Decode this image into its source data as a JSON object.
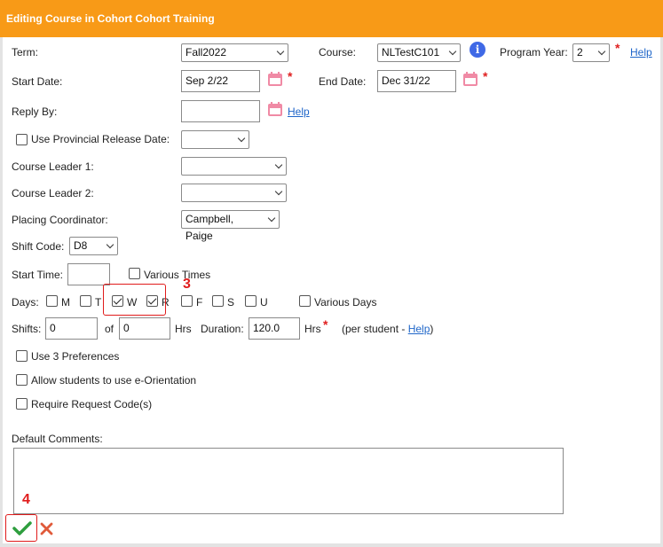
{
  "header": {
    "title": "Editing Course in Cohort Cohort Training"
  },
  "form": {
    "term": {
      "label": "Term:",
      "value": "Fall2022"
    },
    "course": {
      "label": "Course:",
      "value": "NLTestC101"
    },
    "program_year": {
      "label": "Program Year:",
      "value": "2",
      "help": "Help"
    },
    "start_date": {
      "label": "Start Date:",
      "value": "Sep 2/22"
    },
    "end_date": {
      "label": "End Date:",
      "value": "Dec 31/22"
    },
    "reply_by": {
      "label": "Reply By:",
      "value": "",
      "help": "Help"
    },
    "provincial_release": {
      "label": "Use Provincial Release Date:",
      "checked": false,
      "value": ""
    },
    "course_leader_1": {
      "label": "Course Leader 1:",
      "value": ""
    },
    "course_leader_2": {
      "label": "Course Leader 2:",
      "value": ""
    },
    "placing_coordinator": {
      "label": "Placing Coordinator:",
      "value": "Campbell, Paige"
    },
    "shift_code": {
      "label": "Shift Code:",
      "value": "D8"
    },
    "start_time": {
      "label": "Start Time:",
      "value": ""
    },
    "various_times": {
      "label": "Various Times",
      "checked": false
    },
    "days": {
      "label": "Days:",
      "items": [
        {
          "label": "M",
          "checked": false
        },
        {
          "label": "T",
          "checked": false
        },
        {
          "label": "W",
          "checked": true
        },
        {
          "label": "R",
          "checked": true
        },
        {
          "label": "F",
          "checked": false
        },
        {
          "label": "S",
          "checked": false
        },
        {
          "label": "U",
          "checked": false
        }
      ],
      "various": {
        "label": "Various Days",
        "checked": false
      }
    },
    "shifts": {
      "label": "Shifts:",
      "value": "0",
      "of_label": "of",
      "of_value": "0",
      "hrs_label": "Hrs",
      "duration_label": "Duration:",
      "duration_value": "120.0",
      "duration_hrs_label": "Hrs",
      "per_student_prefix": "(per student - ",
      "per_student_help": "Help",
      "per_student_suffix": ")"
    },
    "use_3_preferences": {
      "label": "Use 3 Preferences",
      "checked": false
    },
    "allow_e_orientation": {
      "label": "Allow students to use e-Orientation",
      "checked": false
    },
    "require_request_code": {
      "label": "Require Request Code(s)",
      "checked": false
    },
    "default_comments": {
      "label": "Default Comments:",
      "value": ""
    }
  },
  "required_marker": "*",
  "annotations": {
    "days_step": "3",
    "save_step": "4"
  },
  "colors": {
    "header": "#f89a17",
    "calendar": "#f08aa5",
    "info": "#3f69e6",
    "save": "#2e9e3e",
    "cancel": "#e05a3a",
    "annotation": "#e01b1b"
  },
  "icons": {
    "calendar": "calendar-icon",
    "info": "info-icon",
    "save": "checkmark-icon",
    "cancel": "close-icon"
  }
}
